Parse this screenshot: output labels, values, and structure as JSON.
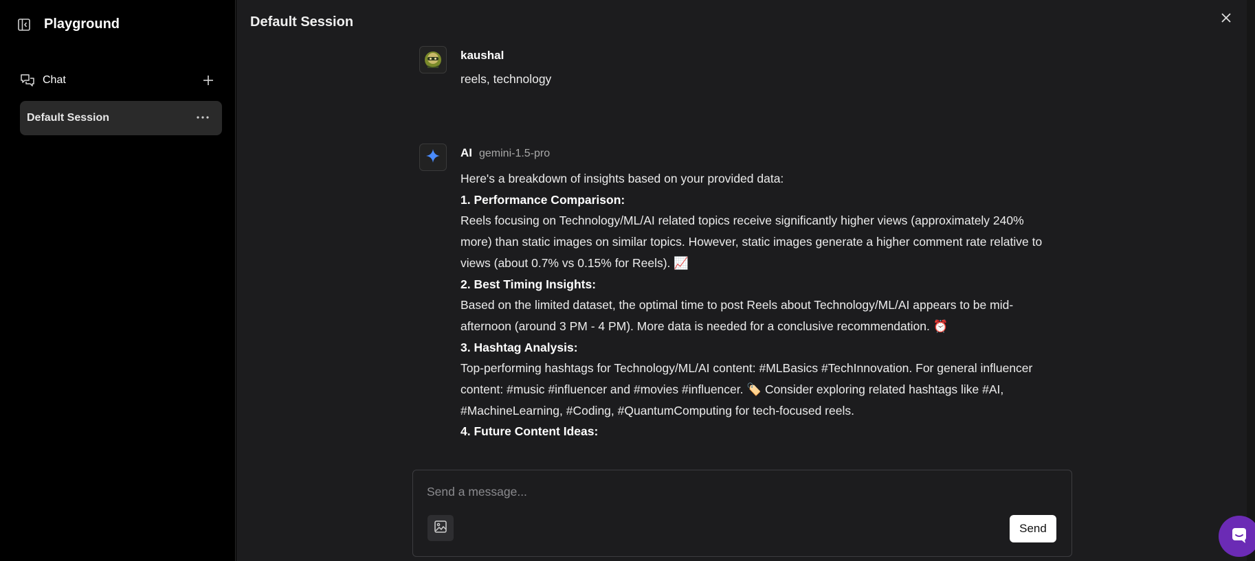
{
  "sidebar": {
    "title": "Playground",
    "chat_label": "Chat",
    "sessions": [
      {
        "label": "Default Session"
      }
    ]
  },
  "main": {
    "title": "Default Session"
  },
  "messages": {
    "user": {
      "name": "kaushal",
      "text": "reels, technology"
    },
    "ai": {
      "name": "AI",
      "model": "gemini-1.5-pro",
      "intro": "Here's a breakdown of insights based on your provided data:",
      "h1": "1. Performance Comparison:",
      "p1": "Reels focusing on Technology/ML/AI related topics receive significantly higher views (approximately 240% more) than static images on similar topics. However, static images generate a higher comment rate relative to views (about 0.7% vs 0.15% for Reels). 📈",
      "h2": "2. Best Timing Insights:",
      "p2": "Based on the limited dataset, the optimal time to post Reels about Technology/ML/AI appears to be mid-afternoon (around 3 PM - 4 PM). More data is needed for a conclusive recommendation. ⏰",
      "h3": "3. Hashtag Analysis:",
      "p3": "Top-performing hashtags for Technology/ML/AI content: #MLBasics #TechInnovation. For general influencer content: #music #influencer and #movies #influencer. 🏷️ Consider exploring related hashtags like #AI, #MachineLearning, #Coding, #QuantumComputing for tech-focused reels.",
      "h4": "4. Future Content Ideas:"
    }
  },
  "composer": {
    "placeholder": "Send a message...",
    "send_label": "Send"
  },
  "colors": {
    "accent_ai": "#4a8cff",
    "fab": "#6b2bb5"
  }
}
